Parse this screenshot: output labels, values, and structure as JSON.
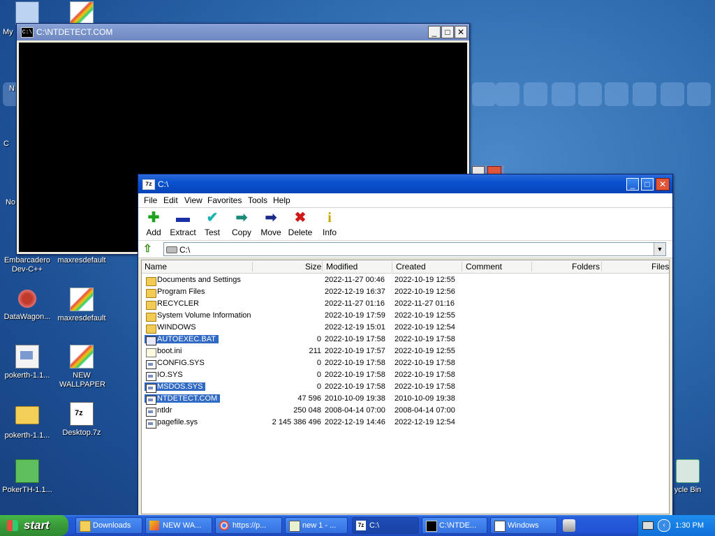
{
  "desktop": {
    "icons": [
      {
        "label": "My",
        "icon": "my-computer-icon"
      },
      {
        "label": "Embarcadero Dev-C++",
        "icon": "devcpp-icon"
      },
      {
        "label": "maxresdefault",
        "icon": "image-icon"
      },
      {
        "label": "DataWagon...",
        "icon": "datawagon-icon"
      },
      {
        "label": "maxresdefault",
        "icon": "image-icon"
      },
      {
        "label": "pokerth-1.1...",
        "icon": "document-icon"
      },
      {
        "label": "NEW WALLPAPER",
        "icon": "image-icon"
      },
      {
        "label": "pokerth-1.1...",
        "icon": "folder-icon"
      },
      {
        "label": "Desktop.7z",
        "icon": "7z-archive-icon"
      },
      {
        "label": "PokerTH-1.1...",
        "icon": "installer-icon"
      },
      {
        "label": "ycle Bin",
        "icon": "recycle-bin-icon"
      },
      {
        "label": "C",
        "icon": "partial-icon"
      },
      {
        "label": "No",
        "icon": "partial-icon"
      },
      {
        "label": "N",
        "icon": "partial-icon"
      }
    ]
  },
  "console_window": {
    "title": "C:\\NTDETECT.COM",
    "icon": "console-icon",
    "icon_text": "C:\\"
  },
  "sevenzip": {
    "title": "C:\\",
    "icon_text": "7z",
    "buttons": {
      "minimize": "_",
      "maximize": "□",
      "close": "✕"
    },
    "menu": [
      "File",
      "Edit",
      "View",
      "Favorites",
      "Tools",
      "Help"
    ],
    "toolbar": [
      {
        "label": "Add",
        "icon": "add-icon",
        "glyph": "✚",
        "color": "#1fa31f"
      },
      {
        "label": "Extract",
        "icon": "extract-icon",
        "glyph": "▬",
        "color": "#1a2ea8"
      },
      {
        "label": "Test",
        "icon": "test-icon",
        "glyph": "✔",
        "color": "#17b2b2"
      },
      {
        "label": "Copy",
        "icon": "copy-icon",
        "glyph": "➡",
        "color": "#178a78"
      },
      {
        "label": "Move",
        "icon": "move-icon",
        "glyph": "➡",
        "color": "#1a2a8a"
      },
      {
        "label": "Delete",
        "icon": "delete-icon",
        "glyph": "✖",
        "color": "#d01818"
      },
      {
        "label": "Info",
        "icon": "info-icon",
        "glyph": "i",
        "color": "#c8a400"
      }
    ],
    "address": "C:\\",
    "columns": [
      "Name",
      "Size",
      "Modified",
      "Created",
      "Comment",
      "Folders",
      "Files"
    ],
    "rows": [
      {
        "name": "Documents and Settings",
        "type": "folder",
        "size": "",
        "modified": "2022-11-27 00:46",
        "created": "2022-10-19 12:55",
        "selected": false
      },
      {
        "name": "Program Files",
        "type": "folder",
        "size": "",
        "modified": "2022-12-19 16:37",
        "created": "2022-10-19 12:56",
        "selected": false
      },
      {
        "name": "RECYCLER",
        "type": "folder",
        "size": "",
        "modified": "2022-11-27 01:16",
        "created": "2022-11-27 01:16",
        "selected": false
      },
      {
        "name": "System Volume Information",
        "type": "folder",
        "size": "",
        "modified": "2022-10-19 17:59",
        "created": "2022-10-19 12:55",
        "selected": false
      },
      {
        "name": "WINDOWS",
        "type": "folder",
        "size": "",
        "modified": "2022-12-19 15:01",
        "created": "2022-10-19 12:54",
        "selected": false
      },
      {
        "name": "AUTOEXEC.BAT",
        "type": "bat",
        "size": "0",
        "modified": "2022-10-19 17:58",
        "created": "2022-10-19 17:58",
        "selected": true
      },
      {
        "name": "boot.ini",
        "type": "ini",
        "size": "211",
        "modified": "2022-10-19 17:57",
        "created": "2022-10-19 12:55",
        "selected": false
      },
      {
        "name": "CONFIG.SYS",
        "type": "file",
        "size": "0",
        "modified": "2022-10-19 17:58",
        "created": "2022-10-19 17:58",
        "selected": false
      },
      {
        "name": "IO.SYS",
        "type": "file",
        "size": "0",
        "modified": "2022-10-19 17:58",
        "created": "2022-10-19 17:58",
        "selected": false
      },
      {
        "name": "MSDOS.SYS",
        "type": "file",
        "size": "0",
        "modified": "2022-10-19 17:58",
        "created": "2022-10-19 17:58",
        "selected": true
      },
      {
        "name": "NTDETECT.COM",
        "type": "file",
        "size": "47 596",
        "modified": "2010-10-09 19:38",
        "created": "2010-10-09 19:38",
        "selected": true
      },
      {
        "name": "ntldr",
        "type": "file",
        "size": "250 048",
        "modified": "2008-04-14 07:00",
        "created": "2008-04-14 07:00",
        "selected": false
      },
      {
        "name": "pagefile.sys",
        "type": "file",
        "size": "2 145 386 496",
        "modified": "2022-12-19 14:46",
        "created": "2022-12-19 12:54",
        "selected": false
      }
    ]
  },
  "taskbar": {
    "start_label": "start",
    "items": [
      {
        "label": "Downloads",
        "icon": "folder-icon",
        "active": false
      },
      {
        "label": "NEW WA...",
        "icon": "paint-icon",
        "active": false
      },
      {
        "label": "https://p...",
        "icon": "chrome-icon",
        "active": false
      },
      {
        "label": "new 1 - ...",
        "icon": "notepad-icon",
        "active": false
      },
      {
        "label": "C:\\",
        "icon": "7zip-icon",
        "active": true
      },
      {
        "label": "C:\\NTDE...",
        "icon": "console-icon",
        "active": false
      },
      {
        "label": "Windows",
        "icon": "window-icon",
        "active": false
      }
    ],
    "clock": "1:30 PM"
  }
}
